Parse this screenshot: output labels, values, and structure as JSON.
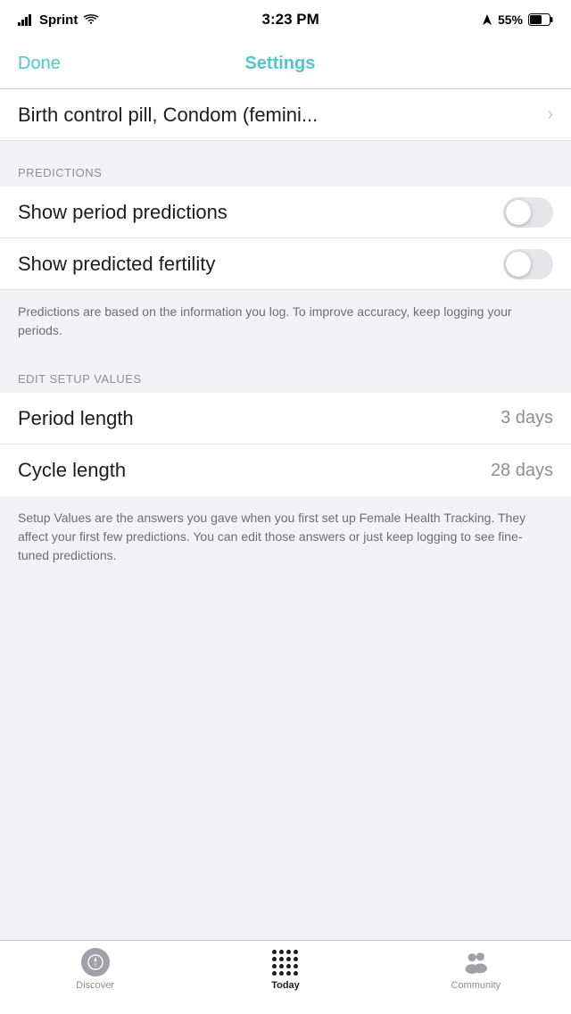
{
  "statusBar": {
    "carrier": "Sprint",
    "time": "3:23 PM",
    "battery": "55%"
  },
  "navBar": {
    "doneLabel": "Done",
    "title": "Settings"
  },
  "sections": {
    "birthControl": {
      "label": "Birth control pill, Condom (femini...",
      "hasChevron": true
    },
    "predictions": {
      "header": "PREDICTIONS",
      "rows": [
        {
          "label": "Show period predictions",
          "toggleOn": false
        },
        {
          "label": "Show predicted fertility",
          "toggleOn": false
        }
      ],
      "note": "Predictions are based on the information you log. To improve accuracy, keep logging your periods."
    },
    "editSetup": {
      "header": "EDIT SETUP VALUES",
      "rows": [
        {
          "label": "Period length",
          "value": "3 days"
        },
        {
          "label": "Cycle length",
          "value": "28 days"
        }
      ],
      "note": "Setup Values are the answers you gave when you first set up Female Health Tracking. They affect your first few predictions. You can edit those answers or just keep logging to see fine-tuned predictions."
    }
  },
  "tabBar": {
    "items": [
      {
        "id": "discover",
        "label": "Discover",
        "active": false
      },
      {
        "id": "today",
        "label": "Today",
        "active": true
      },
      {
        "id": "community",
        "label": "Community",
        "active": false
      }
    ]
  }
}
